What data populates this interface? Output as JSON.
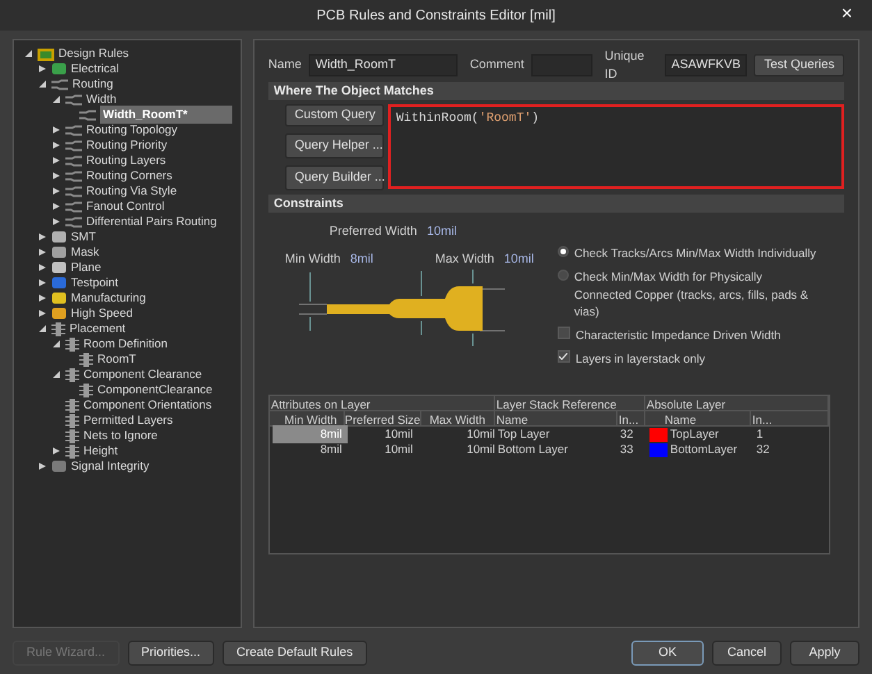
{
  "window": {
    "title": "PCB Rules and Constraints Editor [mil]",
    "close": "×"
  },
  "tree": [
    {
      "label": "Design Rules",
      "kind": "root",
      "expanded": true,
      "selected": false,
      "children": [
        {
          "label": "Electrical",
          "kind": "electrical",
          "expanded": false,
          "selected": false
        },
        {
          "label": "Routing",
          "kind": "routing",
          "expanded": true,
          "selected": false,
          "children": [
            {
              "label": "Width",
              "kind": "routing",
              "expanded": true,
              "selected": false,
              "children": [
                {
                  "label": "Width_RoomT*",
                  "kind": "routing",
                  "selected": true
                }
              ]
            },
            {
              "label": "Routing Topology",
              "kind": "routing",
              "expanded": false,
              "selected": false
            },
            {
              "label": "Routing Priority",
              "kind": "routing",
              "expanded": false,
              "selected": false
            },
            {
              "label": "Routing Layers",
              "kind": "routing",
              "expanded": false,
              "selected": false
            },
            {
              "label": "Routing Corners",
              "kind": "routing",
              "expanded": false,
              "selected": false
            },
            {
              "label": "Routing Via Style",
              "kind": "routing",
              "expanded": false,
              "selected": false
            },
            {
              "label": "Fanout Control",
              "kind": "routing",
              "expanded": false,
              "selected": false
            },
            {
              "label": "Differential Pairs Routing",
              "kind": "routing",
              "expanded": false,
              "selected": false
            }
          ]
        },
        {
          "label": "SMT",
          "kind": "smt",
          "expanded": false,
          "selected": false
        },
        {
          "label": "Mask",
          "kind": "mask",
          "expanded": false,
          "selected": false
        },
        {
          "label": "Plane",
          "kind": "plane",
          "expanded": false,
          "selected": false
        },
        {
          "label": "Testpoint",
          "kind": "testpoint",
          "expanded": false,
          "selected": false
        },
        {
          "label": "Manufacturing",
          "kind": "manufacturing",
          "expanded": false,
          "selected": false
        },
        {
          "label": "High Speed",
          "kind": "highspeed",
          "expanded": false,
          "selected": false
        },
        {
          "label": "Placement",
          "kind": "placement",
          "expanded": true,
          "selected": false,
          "children": [
            {
              "label": "Room Definition",
              "kind": "placement",
              "expanded": true,
              "selected": false,
              "children": [
                {
                  "label": "RoomT",
                  "kind": "placement",
                  "selected": false
                }
              ]
            },
            {
              "label": "Component Clearance",
              "kind": "placement",
              "expanded": true,
              "selected": false,
              "children": [
                {
                  "label": "ComponentClearance",
                  "kind": "placement",
                  "selected": false
                }
              ]
            },
            {
              "label": "Component Orientations",
              "kind": "placement",
              "selected": false
            },
            {
              "label": "Permitted Layers",
              "kind": "placement",
              "selected": false
            },
            {
              "label": "Nets to Ignore",
              "kind": "placement",
              "selected": false
            },
            {
              "label": "Height",
              "kind": "placement",
              "expanded": false,
              "selected": false
            }
          ]
        },
        {
          "label": "Signal Integrity",
          "kind": "signal",
          "expanded": false,
          "selected": false
        }
      ]
    }
  ],
  "rule": {
    "name_label": "Name",
    "name": "Width_RoomT",
    "comment_label": "Comment",
    "unique_id_label": "Unique ID",
    "unique_id": "ASAWFKVB",
    "test_button": "Test Queries"
  },
  "where": {
    "title": "Where The Object Matches",
    "query_type": "Custom Query",
    "helper_button": "Query Helper ...",
    "builder_button": "Query Builder ...",
    "query_func": "WithinRoom(",
    "query_arg": "'RoomT'",
    "query_end": ")"
  },
  "constraints": {
    "title": "Constraints",
    "preferred_label": "Preferred Width",
    "preferred": "10mil",
    "min_label": "Min Width",
    "min": "8mil",
    "max_label": "Max Width",
    "max": "10mil",
    "options": [
      {
        "kind": "radio",
        "label": "Check Tracks/Arcs Min/Max Width Individually",
        "selected": true
      },
      {
        "kind": "radio",
        "label": "Check Min/Max Width for Physically Connected Copper (tracks, arcs, fills, pads & vias)",
        "selected": false
      },
      {
        "kind": "checkbox",
        "label": "Characteristic Impedance Driven Width",
        "checked": false
      },
      {
        "kind": "checkbox",
        "label": "Layers in layerstack only",
        "checked": true
      }
    ]
  },
  "table": {
    "groups": [
      "Attributes on Layer",
      "Layer Stack Reference",
      "Absolute Layer"
    ],
    "columns": [
      "Min Width",
      "Preferred Size",
      "Max Width",
      "Name",
      "In...",
      "Name",
      "In..."
    ],
    "rows": [
      {
        "min": "8mil",
        "preferred": "10mil",
        "max": "10mil",
        "ref_name": "Top Layer",
        "ref_index": "32",
        "color": "#ff0000",
        "abs_name": "TopLayer",
        "abs_index": "1",
        "selected": true
      },
      {
        "min": "8mil",
        "preferred": "10mil",
        "max": "10mil",
        "ref_name": "Bottom Layer",
        "ref_index": "33",
        "color": "#0000ff",
        "abs_name": "BottomLayer",
        "abs_index": "32",
        "selected": false
      }
    ]
  },
  "buttons": [
    {
      "label": "Rule Wizard...",
      "disabled": true,
      "default": false
    },
    {
      "label": "Priorities...",
      "disabled": false,
      "default": false
    },
    {
      "label": "Create Default Rules",
      "disabled": false,
      "default": false
    },
    {
      "label": "OK",
      "disabled": false,
      "default": true
    },
    {
      "label": "Cancel",
      "disabled": false,
      "default": false
    },
    {
      "label": "Apply",
      "disabled": false,
      "default": false
    }
  ]
}
